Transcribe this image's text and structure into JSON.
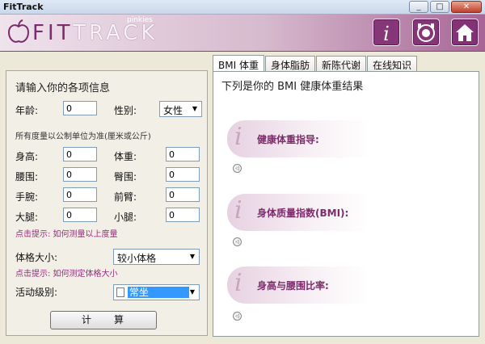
{
  "window": {
    "title": "FitTrack",
    "btn_min": "_",
    "btn_max": "□",
    "btn_close": "✕"
  },
  "header": {
    "brand_part1": "FIT",
    "brand_part2": "TRACK",
    "brand_sub": "pinkies",
    "icons": [
      "info-icon",
      "meal-icon",
      "home-icon"
    ]
  },
  "form": {
    "title": "请输入你的各项信息",
    "age_label": "年龄:",
    "age_value": "0",
    "gender_label": "性别:",
    "gender_value": "女性",
    "unit_note": "所有度量以公制单位为准(厘米或公斤)",
    "height_label": "身高:",
    "height_value": "0",
    "weight_label": "体重:",
    "weight_value": "0",
    "waist_label": "腰围:",
    "waist_value": "0",
    "hip_label": "臀围:",
    "hip_value": "0",
    "wrist_label": "手腕:",
    "wrist_value": "0",
    "forearm_label": "前臂:",
    "forearm_value": "0",
    "thigh_label": "大腿:",
    "thigh_value": "0",
    "calf_label": "小腿:",
    "calf_value": "0",
    "measure_hint": "点击提示: 如何测量以上度量",
    "frame_label": "体格大小:",
    "frame_value": "较小体格",
    "frame_hint": "点击提示: 如何测定体格大小",
    "activity_label": "活动级别:",
    "activity_value": "常坐",
    "calc_button": "计算"
  },
  "tabs": [
    {
      "label": "BMI 体重",
      "active": true
    },
    {
      "label": "身体脂肪",
      "active": false
    },
    {
      "label": "新陈代谢",
      "active": false
    },
    {
      "label": "在线知识",
      "active": false
    }
  ],
  "results": {
    "title": "下列是你的 BMI 健康体重结果",
    "cards": [
      {
        "label": "健康体重指导:"
      },
      {
        "label": "身体质量指数(BMI):"
      },
      {
        "label": "身高与腰围比率:"
      }
    ]
  }
}
